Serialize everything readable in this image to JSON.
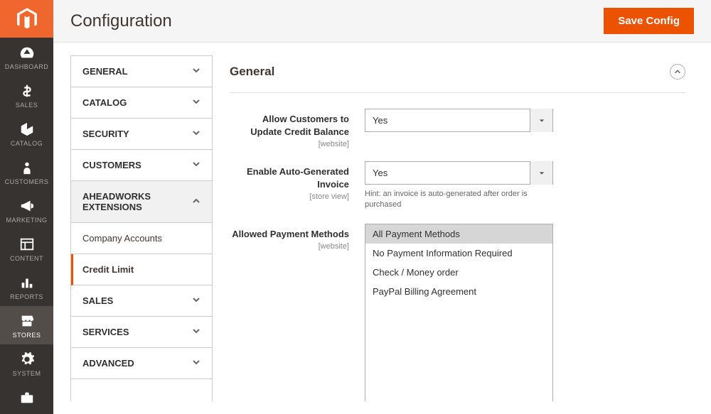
{
  "colors": {
    "accent": "#eb5202",
    "darknav": "#373330",
    "logo_bg": "#ef672f"
  },
  "header": {
    "title": "Configuration",
    "save_label": "Save Config"
  },
  "leftnav": [
    {
      "icon": "dashboard",
      "label": "DASHBOARD"
    },
    {
      "icon": "dollar",
      "label": "SALES"
    },
    {
      "icon": "box",
      "label": "CATALOG"
    },
    {
      "icon": "person",
      "label": "CUSTOMERS"
    },
    {
      "icon": "megaphone",
      "label": "MARKETING"
    },
    {
      "icon": "layout",
      "label": "CONTENT"
    },
    {
      "icon": "bars",
      "label": "REPORTS"
    },
    {
      "icon": "store",
      "label": "STORES"
    },
    {
      "icon": "gear",
      "label": "SYSTEM"
    },
    {
      "icon": "briefcase",
      "label": ""
    }
  ],
  "confignav": [
    {
      "label": "GENERAL",
      "type": "group",
      "open": false
    },
    {
      "label": "CATALOG",
      "type": "group",
      "open": false
    },
    {
      "label": "SECURITY",
      "type": "group",
      "open": false
    },
    {
      "label": "CUSTOMERS",
      "type": "group",
      "open": false
    },
    {
      "label": "AHEADWORKS EXTENSIONS",
      "type": "group",
      "open": true
    },
    {
      "label": "Company Accounts",
      "type": "sub",
      "active": false
    },
    {
      "label": "Credit Limit",
      "type": "sub",
      "active": true
    },
    {
      "label": "SALES",
      "type": "group",
      "open": false
    },
    {
      "label": "SERVICES",
      "type": "group",
      "open": false
    },
    {
      "label": "ADVANCED",
      "type": "group",
      "open": false
    }
  ],
  "section": {
    "title": "General"
  },
  "fields": {
    "allow_update": {
      "label": "Allow Customers to Update Credit Balance",
      "scope": "[website]",
      "value": "Yes"
    },
    "auto_invoice": {
      "label": "Enable Auto-Generated Invoice",
      "scope": "[store view]",
      "value": "Yes",
      "hint": "Hint: an invoice is auto-generated after order is purchased"
    },
    "allowed_methods": {
      "label": "Allowed Payment Methods",
      "scope": "[website]",
      "options": [
        "All Payment Methods",
        "No Payment Information Required",
        "Check / Money order",
        "PayPal Billing Agreement"
      ],
      "selected_index": 0
    }
  }
}
